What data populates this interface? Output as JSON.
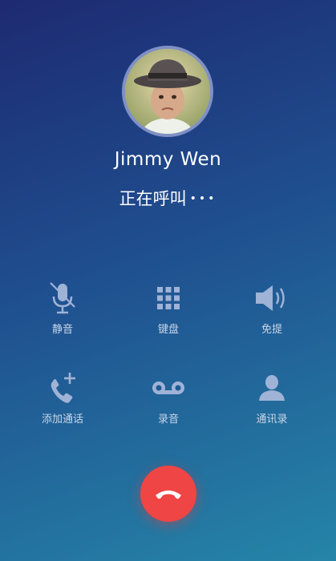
{
  "caller": {
    "name": "Jimmy Wen",
    "status": "正在呼叫",
    "dots": "•••"
  },
  "controls": [
    {
      "id": "mute",
      "label": "静音",
      "icon": "mic-muted-icon"
    },
    {
      "id": "keypad",
      "label": "键盘",
      "icon": "keypad-icon"
    },
    {
      "id": "speaker",
      "label": "免提",
      "icon": "speaker-icon"
    },
    {
      "id": "add-call",
      "label": "添加通话",
      "icon": "add-call-icon"
    },
    {
      "id": "record",
      "label": "录音",
      "icon": "voicemail-record-icon"
    },
    {
      "id": "contacts",
      "label": "通讯录",
      "icon": "contact-person-icon"
    }
  ],
  "end_call": {
    "icon": "hang-up-phone-icon",
    "color": "#ef4545"
  },
  "colors": {
    "background_top": "#1e2a72",
    "background_bottom": "#2585a8",
    "icon": "#9fb3d6",
    "label": "#c9d6ea",
    "avatar_ring": "#7f90c4"
  }
}
